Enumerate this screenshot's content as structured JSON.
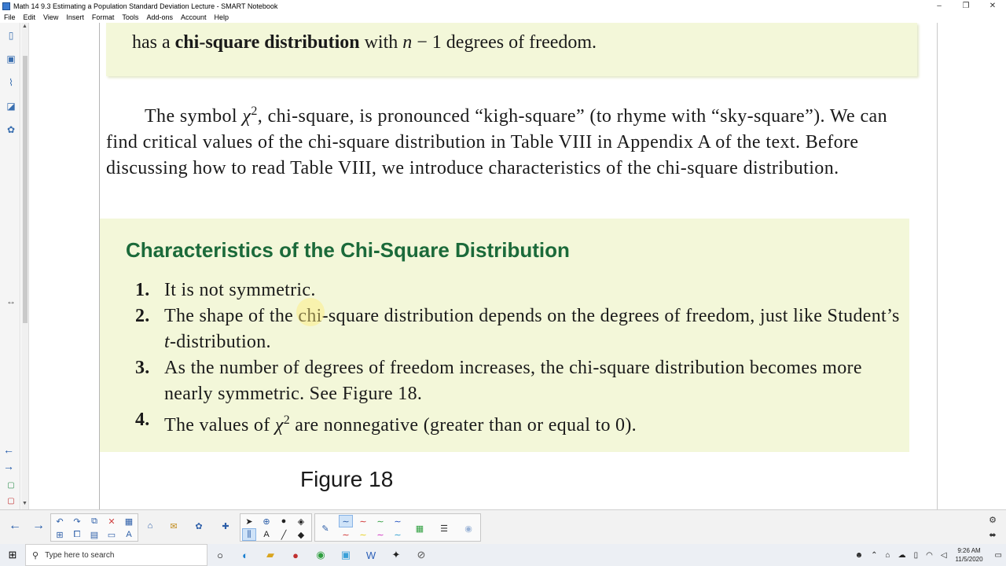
{
  "window": {
    "title": "Math 14 9.3 Estimating a Population Standard Deviation Lecture - SMART Notebook",
    "minimize": "–",
    "restore": "❐",
    "close": "✕"
  },
  "menu": [
    "File",
    "Edit",
    "View",
    "Insert",
    "Format",
    "Tools",
    "Add-ons",
    "Account",
    "Help"
  ],
  "content": {
    "top_band": {
      "prefix": "has a ",
      "bold": "chi-square distribution",
      "middle": " with ",
      "n": "n",
      "suffix": " − 1 degrees of freedom."
    },
    "paragraph": {
      "p1": "The symbol ",
      "chi": "χ",
      "sup": "2",
      "p2": ", chi-square, is pronounced “kigh-square” (to rhyme with “sky-square”). We can find critical values of the chi-square distribution in Table VIII in Appendix A of the text. Before discussing how to read Table VIII, we introduce characteristics of the chi-square distribution."
    },
    "box": {
      "heading": "Characteristics of the Chi-Square Distribution",
      "items": [
        {
          "num": "1.",
          "text": "It is not symmetric."
        },
        {
          "num": "2.",
          "text_a": "The shape of the chi-square distribution depends on the degrees of freedom, just like Student’s ",
          "italic": "t",
          "text_b": "-distribution."
        },
        {
          "num": "3.",
          "text": "As the number of degrees of freedom increases, the chi-square distribution becomes more nearly symmetric. See Figure 18."
        },
        {
          "num": "4.",
          "text_a": "The values of ",
          "chi": "χ",
          "sup": "2",
          "text_b": " are nonnegative (greater than or equal to 0)."
        }
      ]
    },
    "figure_label": "Figure 18"
  },
  "taskbar": {
    "search_placeholder": "Type here to search",
    "time": "9:26 AM",
    "date": "11/5/2020"
  },
  "colors": {
    "band": "#f3f7d9",
    "heading": "#1b6a3a",
    "accent": "#2c5ea8"
  }
}
